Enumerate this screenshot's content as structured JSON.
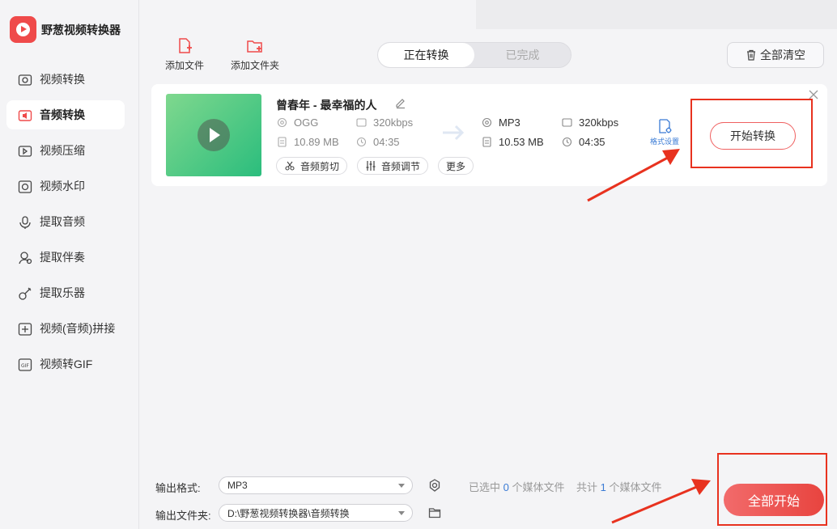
{
  "app": {
    "name": "野葱视频转换器"
  },
  "sidebar": {
    "items": [
      {
        "label": "视频转换",
        "icon": "video-convert-icon"
      },
      {
        "label": "音频转换",
        "icon": "audio-convert-icon",
        "active": true
      },
      {
        "label": "视频压缩",
        "icon": "video-compress-icon"
      },
      {
        "label": "视频水印",
        "icon": "video-watermark-icon"
      },
      {
        "label": "提取音频",
        "icon": "extract-audio-icon"
      },
      {
        "label": "提取伴奏",
        "icon": "extract-accompaniment-icon"
      },
      {
        "label": "提取乐器",
        "icon": "extract-instrument-icon"
      },
      {
        "label": "视频(音频)拼接",
        "icon": "merge-icon"
      },
      {
        "label": "视频转GIF",
        "icon": "gif-icon"
      }
    ]
  },
  "toolbar": {
    "add_file": "添加文件",
    "add_folder": "添加文件夹",
    "clear_all": "全部清空"
  },
  "tabs": [
    {
      "label": "正在转换",
      "active": true
    },
    {
      "label": "已完成",
      "active": false
    }
  ],
  "file": {
    "name": "曾春年 - 最幸福的人",
    "source": {
      "format": "OGG",
      "bitrate": "320kbps",
      "size": "10.89 MB",
      "duration": "04:35"
    },
    "target": {
      "format": "MP3",
      "bitrate": "320kbps",
      "size": "10.53 MB",
      "duration": "04:35"
    },
    "actions": {
      "cut": "音频剪切",
      "adjust": "音频调节",
      "more": "更多"
    },
    "format_settings": "格式设置",
    "start_button": "开始转换"
  },
  "bottom": {
    "output_format_label": "输出格式:",
    "output_format_value": "MP3",
    "output_folder_label": "输出文件夹:",
    "output_folder_value": "D:\\野葱视频转换器\\音频转换",
    "selected_prefix": "已选中",
    "selected_count": "0",
    "selected_suffix": "个媒体文件",
    "total_prefix": "共计",
    "total_count": "1",
    "total_suffix": "个媒体文件",
    "start_all": "全部开始"
  },
  "colors": {
    "accent": "#ef4a4a",
    "link": "#3a7bd5",
    "annotation": "#e8321f"
  }
}
